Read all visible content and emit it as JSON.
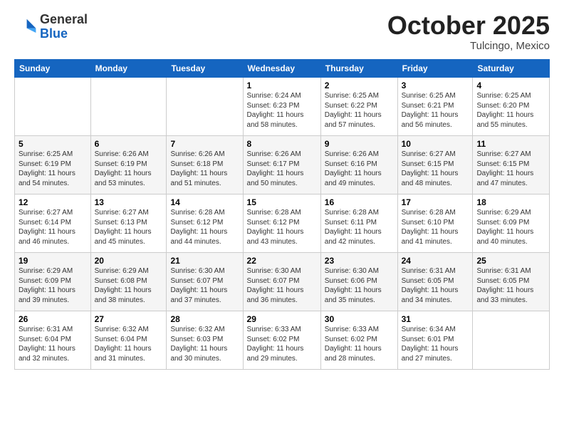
{
  "header": {
    "logo_general": "General",
    "logo_blue": "Blue",
    "month": "October 2025",
    "location": "Tulcingo, Mexico"
  },
  "days_of_week": [
    "Sunday",
    "Monday",
    "Tuesday",
    "Wednesday",
    "Thursday",
    "Friday",
    "Saturday"
  ],
  "weeks": [
    [
      {
        "day": "",
        "info": ""
      },
      {
        "day": "",
        "info": ""
      },
      {
        "day": "",
        "info": ""
      },
      {
        "day": "1",
        "info": "Sunrise: 6:24 AM\nSunset: 6:23 PM\nDaylight: 11 hours\nand 58 minutes."
      },
      {
        "day": "2",
        "info": "Sunrise: 6:25 AM\nSunset: 6:22 PM\nDaylight: 11 hours\nand 57 minutes."
      },
      {
        "day": "3",
        "info": "Sunrise: 6:25 AM\nSunset: 6:21 PM\nDaylight: 11 hours\nand 56 minutes."
      },
      {
        "day": "4",
        "info": "Sunrise: 6:25 AM\nSunset: 6:20 PM\nDaylight: 11 hours\nand 55 minutes."
      }
    ],
    [
      {
        "day": "5",
        "info": "Sunrise: 6:25 AM\nSunset: 6:19 PM\nDaylight: 11 hours\nand 54 minutes."
      },
      {
        "day": "6",
        "info": "Sunrise: 6:26 AM\nSunset: 6:19 PM\nDaylight: 11 hours\nand 53 minutes."
      },
      {
        "day": "7",
        "info": "Sunrise: 6:26 AM\nSunset: 6:18 PM\nDaylight: 11 hours\nand 51 minutes."
      },
      {
        "day": "8",
        "info": "Sunrise: 6:26 AM\nSunset: 6:17 PM\nDaylight: 11 hours\nand 50 minutes."
      },
      {
        "day": "9",
        "info": "Sunrise: 6:26 AM\nSunset: 6:16 PM\nDaylight: 11 hours\nand 49 minutes."
      },
      {
        "day": "10",
        "info": "Sunrise: 6:27 AM\nSunset: 6:15 PM\nDaylight: 11 hours\nand 48 minutes."
      },
      {
        "day": "11",
        "info": "Sunrise: 6:27 AM\nSunset: 6:15 PM\nDaylight: 11 hours\nand 47 minutes."
      }
    ],
    [
      {
        "day": "12",
        "info": "Sunrise: 6:27 AM\nSunset: 6:14 PM\nDaylight: 11 hours\nand 46 minutes."
      },
      {
        "day": "13",
        "info": "Sunrise: 6:27 AM\nSunset: 6:13 PM\nDaylight: 11 hours\nand 45 minutes."
      },
      {
        "day": "14",
        "info": "Sunrise: 6:28 AM\nSunset: 6:12 PM\nDaylight: 11 hours\nand 44 minutes."
      },
      {
        "day": "15",
        "info": "Sunrise: 6:28 AM\nSunset: 6:12 PM\nDaylight: 11 hours\nand 43 minutes."
      },
      {
        "day": "16",
        "info": "Sunrise: 6:28 AM\nSunset: 6:11 PM\nDaylight: 11 hours\nand 42 minutes."
      },
      {
        "day": "17",
        "info": "Sunrise: 6:28 AM\nSunset: 6:10 PM\nDaylight: 11 hours\nand 41 minutes."
      },
      {
        "day": "18",
        "info": "Sunrise: 6:29 AM\nSunset: 6:09 PM\nDaylight: 11 hours\nand 40 minutes."
      }
    ],
    [
      {
        "day": "19",
        "info": "Sunrise: 6:29 AM\nSunset: 6:09 PM\nDaylight: 11 hours\nand 39 minutes."
      },
      {
        "day": "20",
        "info": "Sunrise: 6:29 AM\nSunset: 6:08 PM\nDaylight: 11 hours\nand 38 minutes."
      },
      {
        "day": "21",
        "info": "Sunrise: 6:30 AM\nSunset: 6:07 PM\nDaylight: 11 hours\nand 37 minutes."
      },
      {
        "day": "22",
        "info": "Sunrise: 6:30 AM\nSunset: 6:07 PM\nDaylight: 11 hours\nand 36 minutes."
      },
      {
        "day": "23",
        "info": "Sunrise: 6:30 AM\nSunset: 6:06 PM\nDaylight: 11 hours\nand 35 minutes."
      },
      {
        "day": "24",
        "info": "Sunrise: 6:31 AM\nSunset: 6:05 PM\nDaylight: 11 hours\nand 34 minutes."
      },
      {
        "day": "25",
        "info": "Sunrise: 6:31 AM\nSunset: 6:05 PM\nDaylight: 11 hours\nand 33 minutes."
      }
    ],
    [
      {
        "day": "26",
        "info": "Sunrise: 6:31 AM\nSunset: 6:04 PM\nDaylight: 11 hours\nand 32 minutes."
      },
      {
        "day": "27",
        "info": "Sunrise: 6:32 AM\nSunset: 6:04 PM\nDaylight: 11 hours\nand 31 minutes."
      },
      {
        "day": "28",
        "info": "Sunrise: 6:32 AM\nSunset: 6:03 PM\nDaylight: 11 hours\nand 30 minutes."
      },
      {
        "day": "29",
        "info": "Sunrise: 6:33 AM\nSunset: 6:02 PM\nDaylight: 11 hours\nand 29 minutes."
      },
      {
        "day": "30",
        "info": "Sunrise: 6:33 AM\nSunset: 6:02 PM\nDaylight: 11 hours\nand 28 minutes."
      },
      {
        "day": "31",
        "info": "Sunrise: 6:34 AM\nSunset: 6:01 PM\nDaylight: 11 hours\nand 27 minutes."
      },
      {
        "day": "",
        "info": ""
      }
    ]
  ]
}
